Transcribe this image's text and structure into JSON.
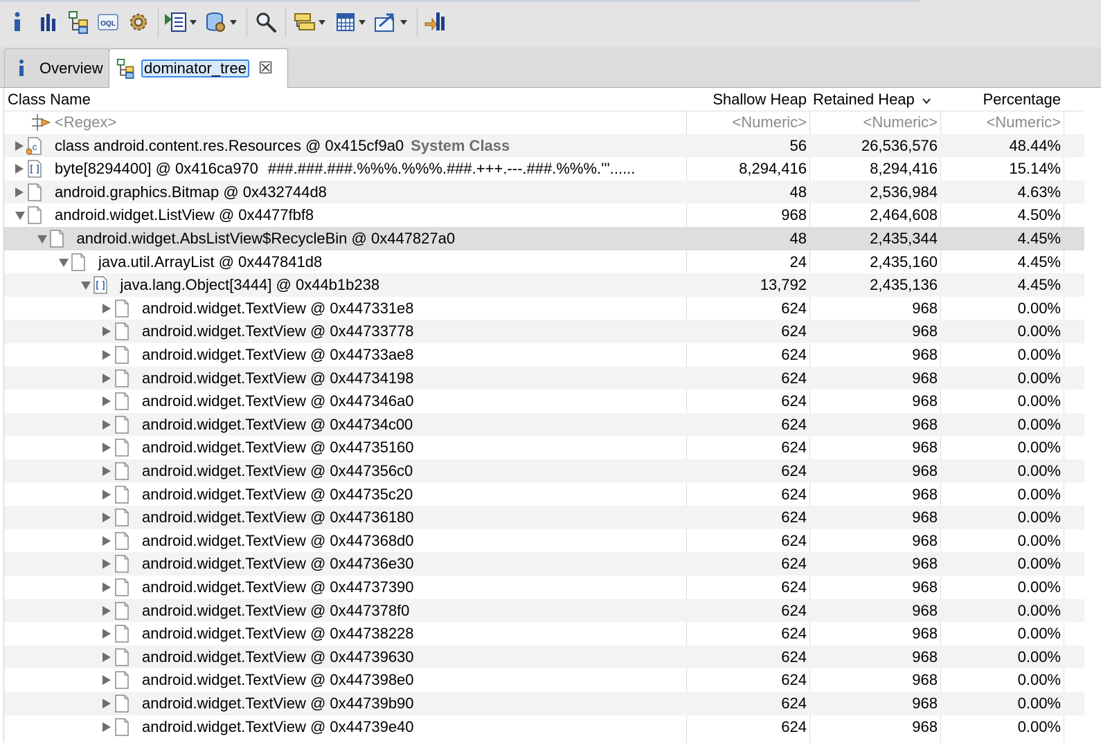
{
  "toolbar": {
    "buttons": [
      {
        "name": "info-icon"
      },
      {
        "name": "histogram-icon"
      },
      {
        "name": "dominator-tree-icon"
      },
      {
        "name": "oql-icon"
      },
      {
        "name": "gear-icon"
      },
      {
        "name": "query-browser-icon",
        "dropdown": true
      },
      {
        "name": "heap-dump-icon",
        "dropdown": true
      },
      {
        "name": "search-icon"
      },
      {
        "name": "group-by-icon",
        "dropdown": true
      },
      {
        "name": "calculator-icon",
        "dropdown": true
      },
      {
        "name": "export-icon",
        "dropdown": true
      },
      {
        "name": "pin-icon"
      }
    ],
    "oql_label": "OQL"
  },
  "tabs": [
    {
      "label": "Overview",
      "icon": "info-icon"
    },
    {
      "label": "dominator_tree",
      "icon": "dominator-tree-icon",
      "active": true
    }
  ],
  "columns": {
    "class_name": "Class Name",
    "shallow_heap": "Shallow Heap",
    "retained_heap": "Retained Heap",
    "percentage": "Percentage"
  },
  "filter": {
    "regex": "<Regex>",
    "numeric1": "<Numeric>",
    "numeric2": "<Numeric>",
    "numeric3": "<Numeric>"
  },
  "rows": [
    {
      "level": 0,
      "expander": "right",
      "icon": "class",
      "name": "class android.content.res.Resources @ 0x415cf9a0",
      "badge": "System Class",
      "shallow": "56",
      "retained": "26,536,576",
      "pct": "48.44%"
    },
    {
      "level": 0,
      "expander": "right",
      "icon": "array",
      "name": "byte[8294400] @ 0x416ca970",
      "extra": "###.###.###.%%%.%%%.###.+++.---.###.%%%.'''......",
      "shallow": "8,294,416",
      "retained": "8,294,416",
      "pct": "15.14%"
    },
    {
      "level": 0,
      "expander": "right",
      "icon": "object",
      "name": "android.graphics.Bitmap @ 0x432744d8",
      "shallow": "48",
      "retained": "2,536,984",
      "pct": "4.63%"
    },
    {
      "level": 0,
      "expander": "down",
      "icon": "object",
      "name": "android.widget.ListView @ 0x4477fbf8",
      "shallow": "968",
      "retained": "2,464,608",
      "pct": "4.50%"
    },
    {
      "level": 1,
      "expander": "down",
      "icon": "object",
      "name": "android.widget.AbsListView$RecycleBin @ 0x447827a0",
      "shallow": "48",
      "retained": "2,435,344",
      "pct": "4.45%",
      "selected": true
    },
    {
      "level": 2,
      "expander": "down",
      "icon": "object",
      "name": "java.util.ArrayList @ 0x447841d8",
      "shallow": "24",
      "retained": "2,435,160",
      "pct": "4.45%"
    },
    {
      "level": 3,
      "expander": "down",
      "icon": "array",
      "name": "java.lang.Object[3444] @ 0x44b1b238",
      "shallow": "13,792",
      "retained": "2,435,136",
      "pct": "4.45%"
    },
    {
      "level": 4,
      "expander": "right",
      "icon": "object",
      "name": "android.widget.TextView @ 0x447331e8",
      "shallow": "624",
      "retained": "968",
      "pct": "0.00%"
    },
    {
      "level": 4,
      "expander": "right",
      "icon": "object",
      "name": "android.widget.TextView @ 0x44733778",
      "shallow": "624",
      "retained": "968",
      "pct": "0.00%"
    },
    {
      "level": 4,
      "expander": "right",
      "icon": "object",
      "name": "android.widget.TextView @ 0x44733ae8",
      "shallow": "624",
      "retained": "968",
      "pct": "0.00%"
    },
    {
      "level": 4,
      "expander": "right",
      "icon": "object",
      "name": "android.widget.TextView @ 0x44734198",
      "shallow": "624",
      "retained": "968",
      "pct": "0.00%"
    },
    {
      "level": 4,
      "expander": "right",
      "icon": "object",
      "name": "android.widget.TextView @ 0x447346a0",
      "shallow": "624",
      "retained": "968",
      "pct": "0.00%"
    },
    {
      "level": 4,
      "expander": "right",
      "icon": "object",
      "name": "android.widget.TextView @ 0x44734c00",
      "shallow": "624",
      "retained": "968",
      "pct": "0.00%"
    },
    {
      "level": 4,
      "expander": "right",
      "icon": "object",
      "name": "android.widget.TextView @ 0x44735160",
      "shallow": "624",
      "retained": "968",
      "pct": "0.00%"
    },
    {
      "level": 4,
      "expander": "right",
      "icon": "object",
      "name": "android.widget.TextView @ 0x447356c0",
      "shallow": "624",
      "retained": "968",
      "pct": "0.00%"
    },
    {
      "level": 4,
      "expander": "right",
      "icon": "object",
      "name": "android.widget.TextView @ 0x44735c20",
      "shallow": "624",
      "retained": "968",
      "pct": "0.00%"
    },
    {
      "level": 4,
      "expander": "right",
      "icon": "object",
      "name": "android.widget.TextView @ 0x44736180",
      "shallow": "624",
      "retained": "968",
      "pct": "0.00%"
    },
    {
      "level": 4,
      "expander": "right",
      "icon": "object",
      "name": "android.widget.TextView @ 0x447368d0",
      "shallow": "624",
      "retained": "968",
      "pct": "0.00%"
    },
    {
      "level": 4,
      "expander": "right",
      "icon": "object",
      "name": "android.widget.TextView @ 0x44736e30",
      "shallow": "624",
      "retained": "968",
      "pct": "0.00%"
    },
    {
      "level": 4,
      "expander": "right",
      "icon": "object",
      "name": "android.widget.TextView @ 0x44737390",
      "shallow": "624",
      "retained": "968",
      "pct": "0.00%"
    },
    {
      "level": 4,
      "expander": "right",
      "icon": "object",
      "name": "android.widget.TextView @ 0x447378f0",
      "shallow": "624",
      "retained": "968",
      "pct": "0.00%"
    },
    {
      "level": 4,
      "expander": "right",
      "icon": "object",
      "name": "android.widget.TextView @ 0x44738228",
      "shallow": "624",
      "retained": "968",
      "pct": "0.00%"
    },
    {
      "level": 4,
      "expander": "right",
      "icon": "object",
      "name": "android.widget.TextView @ 0x44739630",
      "shallow": "624",
      "retained": "968",
      "pct": "0.00%"
    },
    {
      "level": 4,
      "expander": "right",
      "icon": "object",
      "name": "android.widget.TextView @ 0x447398e0",
      "shallow": "624",
      "retained": "968",
      "pct": "0.00%"
    },
    {
      "level": 4,
      "expander": "right",
      "icon": "object",
      "name": "android.widget.TextView @ 0x44739b90",
      "shallow": "624",
      "retained": "968",
      "pct": "0.00%"
    },
    {
      "level": 4,
      "expander": "right",
      "icon": "object",
      "name": "android.widget.TextView @ 0x44739e40",
      "shallow": "624",
      "retained": "968",
      "pct": "0.00%"
    }
  ]
}
